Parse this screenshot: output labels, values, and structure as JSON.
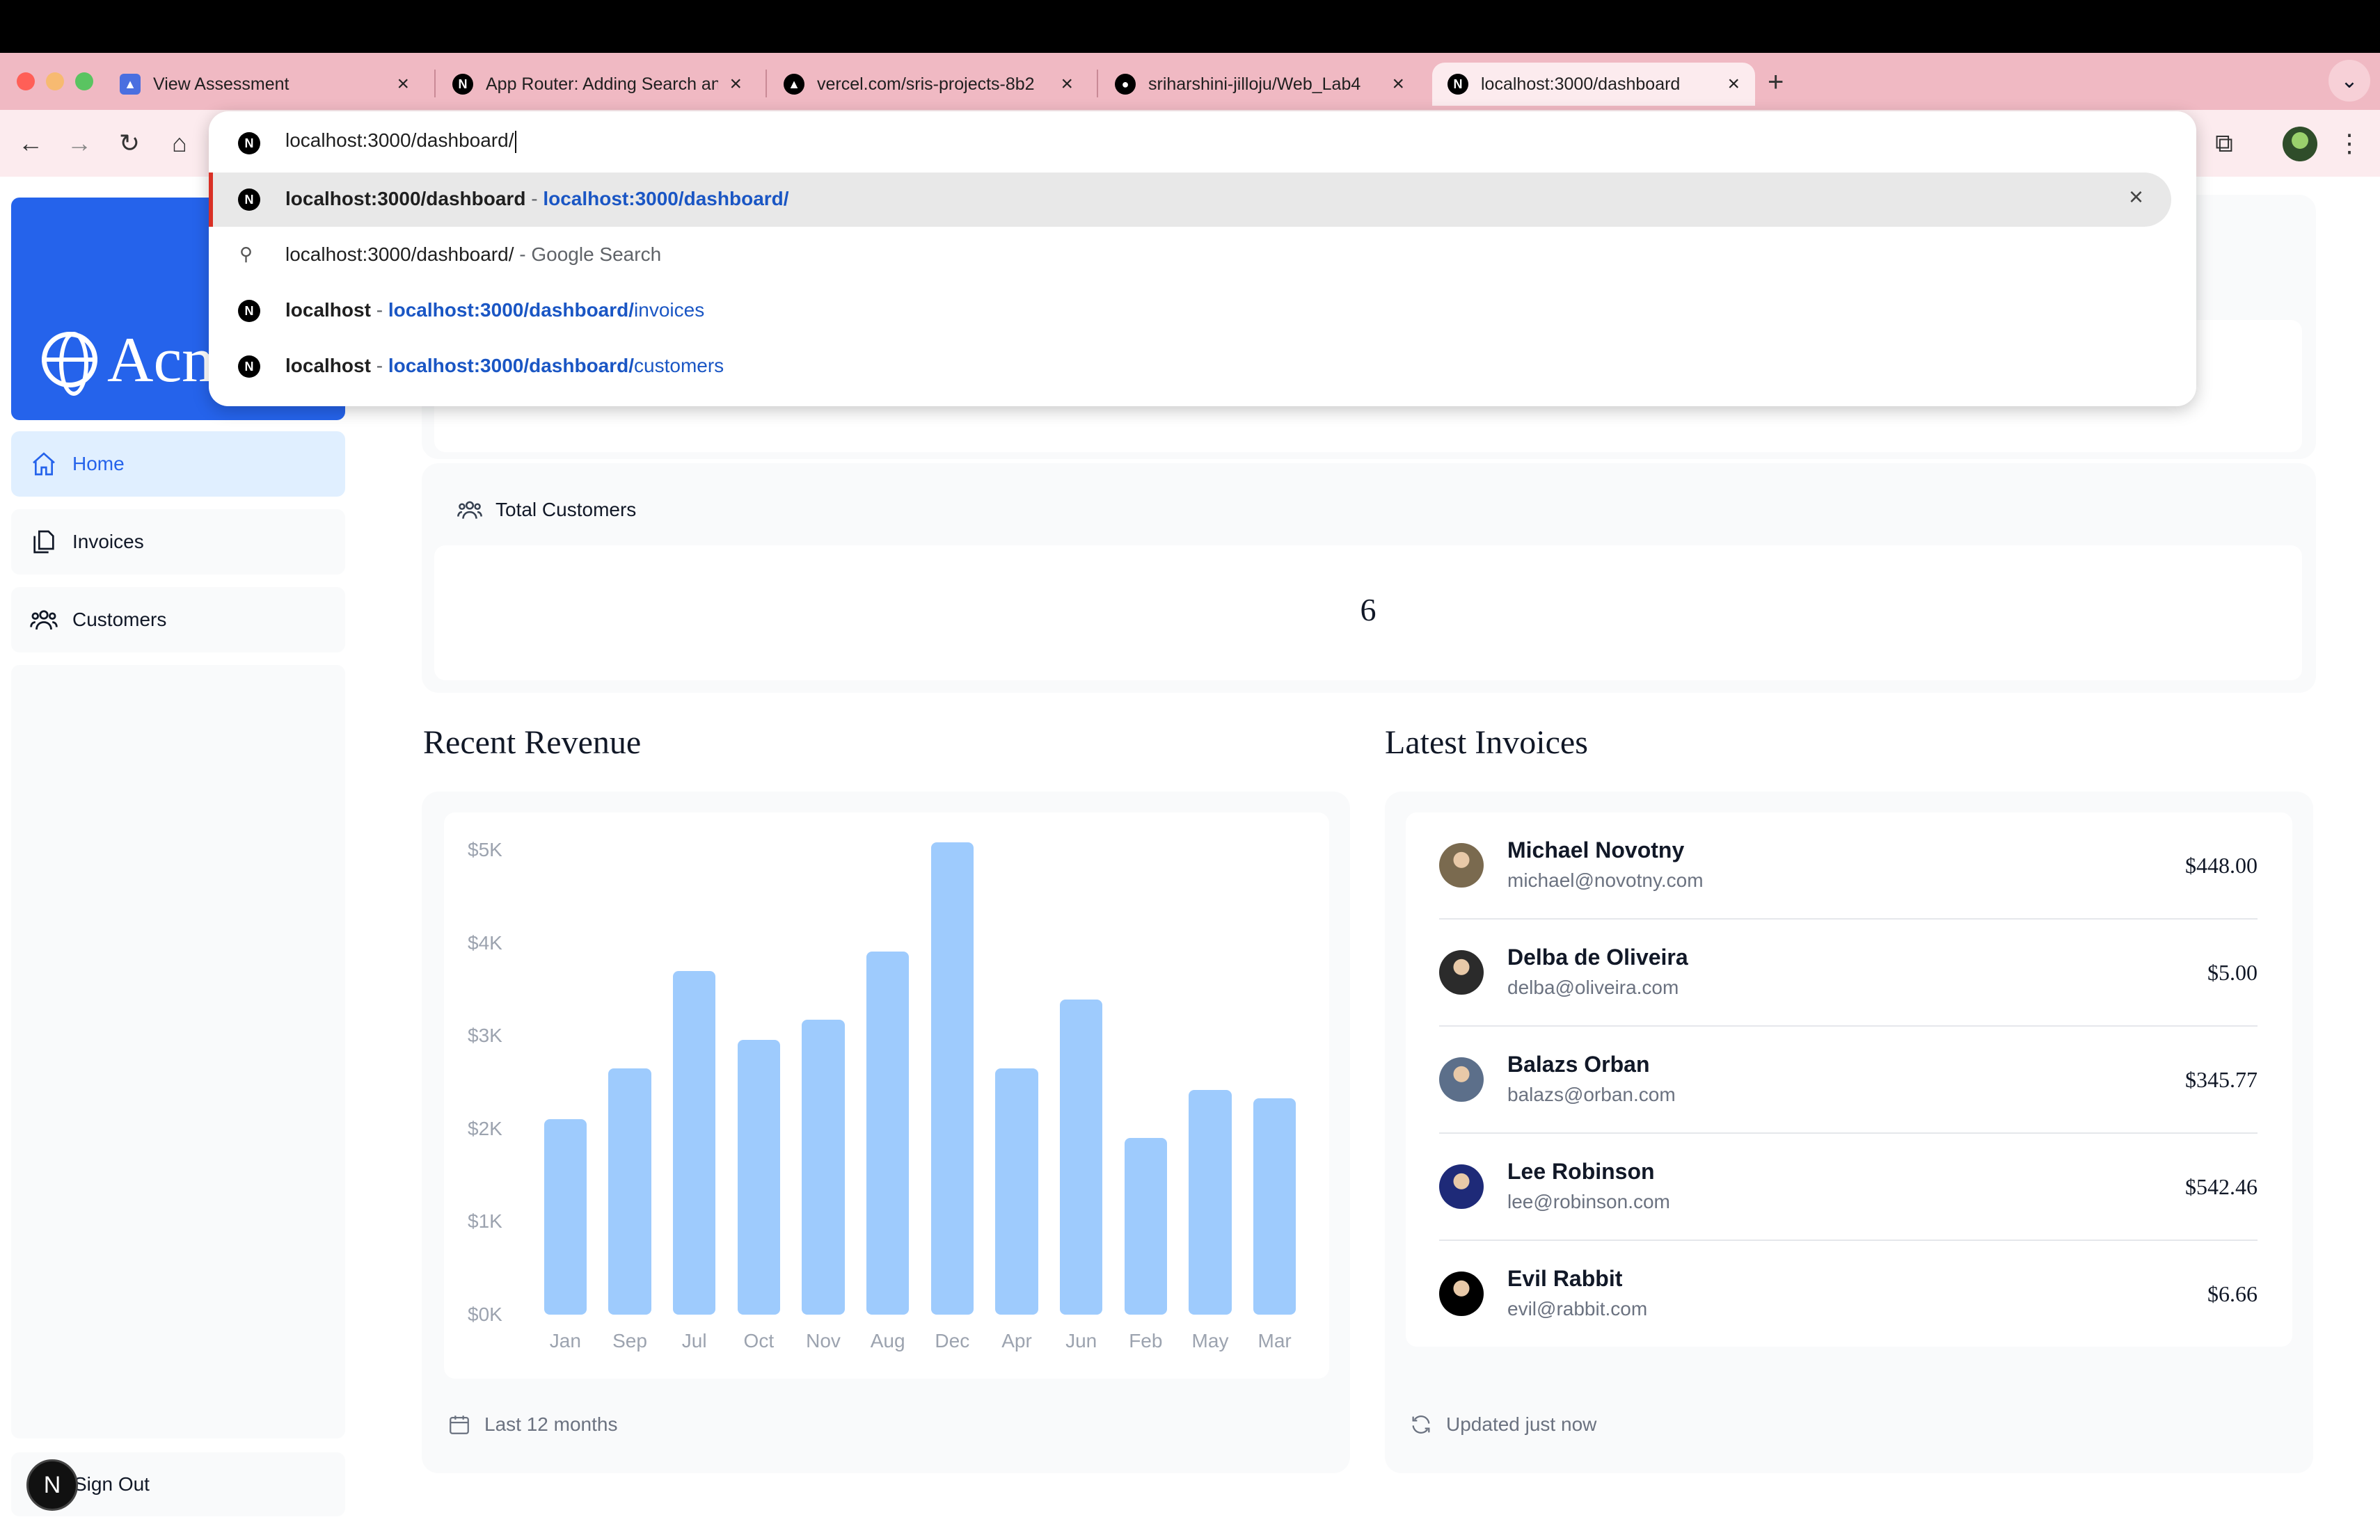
{
  "browser": {
    "tabs": [
      {
        "title": "View Assessment",
        "favicon": "assessment-favicon"
      },
      {
        "title": "App Router: Adding Search and Pagination",
        "favicon": "nextjs-favicon"
      },
      {
        "title": "vercel.com/sris-projects-8b2",
        "favicon": "vercel-favicon"
      },
      {
        "title": "sriharshini-jilloju/Web_Lab4",
        "favicon": "github-favicon"
      },
      {
        "title": "localhost:3000/dashboard",
        "favicon": "nextjs-favicon",
        "active": true
      }
    ],
    "new_tab": "+",
    "tab_close": "×"
  },
  "omnibox": {
    "input_value": "localhost:3000/dashboard/",
    "suggestions": [
      {
        "title": "localhost:3000/dashboard",
        "separator": " - ",
        "url_bold": "localhost:3000/dashboard/",
        "url_rest": "",
        "type": "history",
        "selected": true
      },
      {
        "title": "localhost:3000/dashboard/",
        "separator": " - ",
        "suffix": "Google Search",
        "type": "search"
      },
      {
        "title": "localhost",
        "separator": " - ",
        "url_bold": "localhost:3000/dashboard/",
        "url_rest": "invoices",
        "type": "history"
      },
      {
        "title": "localhost",
        "separator": " - ",
        "url_bold": "localhost:3000/dashboard/",
        "url_rest": "customers",
        "type": "history"
      }
    ],
    "remove_label": "×"
  },
  "sidebar": {
    "logo_text": "Acme",
    "items": [
      {
        "label": "Home",
        "icon": "home-icon",
        "active": true
      },
      {
        "label": "Invoices",
        "icon": "document-icon"
      },
      {
        "label": "Customers",
        "icon": "users-icon"
      }
    ],
    "sign_out": "Sign Out",
    "badge": "N"
  },
  "main": {
    "total_customers": {
      "label": "Total Customers",
      "value": "6"
    },
    "revenue": {
      "title": "Recent Revenue",
      "footer": "Last 12 months"
    },
    "invoices": {
      "title": "Latest Invoices",
      "footer": "Updated just now",
      "rows": [
        {
          "name": "Michael Novotny",
          "email": "michael@novotny.com",
          "amount": "$448.00",
          "avatar_color": "#7a6a4f"
        },
        {
          "name": "Delba de Oliveira",
          "email": "delba@oliveira.com",
          "amount": "$5.00",
          "avatar_color": "#2b2b2b"
        },
        {
          "name": "Balazs Orban",
          "email": "balazs@orban.com",
          "amount": "$345.77",
          "avatar_color": "#5c6f8a"
        },
        {
          "name": "Lee Robinson",
          "email": "lee@robinson.com",
          "amount": "$542.46",
          "avatar_color": "#1e2a78"
        },
        {
          "name": "Evil Rabbit",
          "email": "evil@rabbit.com",
          "amount": "$6.66",
          "avatar_color": "#000000"
        }
      ]
    }
  },
  "chart_data": {
    "type": "bar",
    "categories": [
      "Jan",
      "Sep",
      "Jul",
      "Oct",
      "Nov",
      "Aug",
      "Dec",
      "Apr",
      "Jun",
      "Feb",
      "May",
      "Mar"
    ],
    "values": [
      2100,
      2650,
      3700,
      2960,
      3170,
      3910,
      5080,
      2650,
      3390,
      1900,
      2420,
      2330
    ],
    "y_ticks": [
      "$0K",
      "$1K",
      "$2K",
      "$3K",
      "$4K",
      "$5K"
    ],
    "ylim": [
      0,
      5000
    ],
    "bar_color": "#93c5fd",
    "grid": false,
    "title": ""
  },
  "colors": {
    "accent": "#2563eb",
    "tab_bar": "#f0b9c3",
    "link": "#1a56c4"
  }
}
